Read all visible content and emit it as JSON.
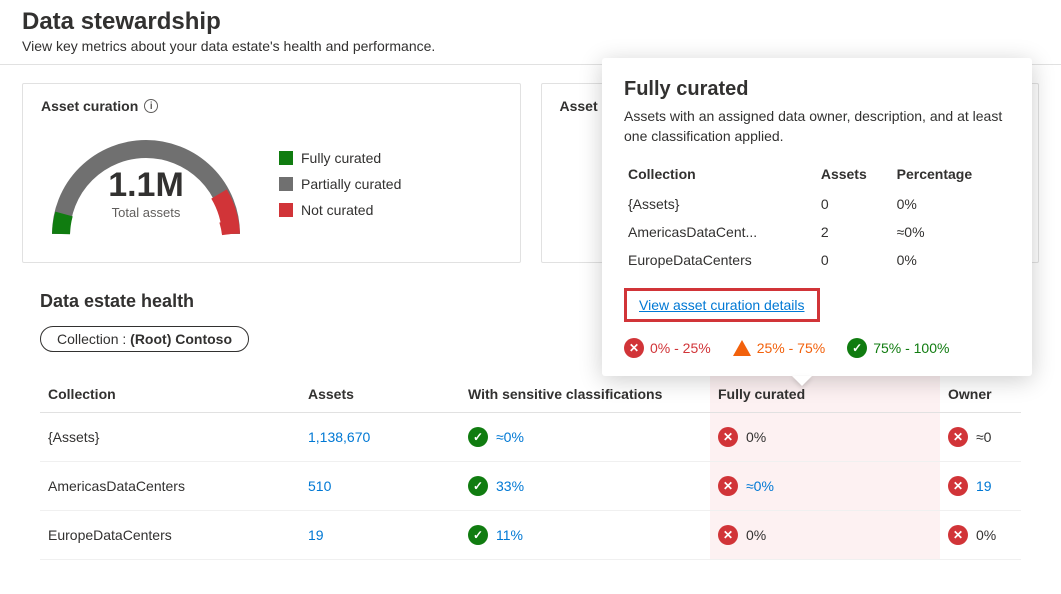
{
  "page": {
    "title": "Data stewardship",
    "subtitle": "View key metrics about your data estate's health and performance."
  },
  "cards": {
    "assetCuration": {
      "title": "Asset curation",
      "total_value": "1.1M",
      "total_label": "Total assets",
      "legend": {
        "fully": "Fully curated",
        "partially": "Partially curated",
        "not": "Not curated"
      }
    },
    "second": {
      "title": "Asset c"
    }
  },
  "popover": {
    "title": "Fully curated",
    "desc": "Assets with an assigned data owner, description, and at least one classification applied.",
    "headers": {
      "collection": "Collection",
      "assets": "Assets",
      "percentage": "Percentage"
    },
    "rows": [
      {
        "collection": "{Assets}",
        "assets": "0",
        "percentage": "0%"
      },
      {
        "collection": "AmericasDataCent...",
        "assets": "2",
        "percentage": "≈0%"
      },
      {
        "collection": "EuropeDataCenters",
        "assets": "0",
        "percentage": "0%"
      }
    ],
    "detail_link": "View asset curation details",
    "ranges": {
      "low": "0% - 25%",
      "mid": "25% - 75%",
      "high": "75% - 100%"
    }
  },
  "health": {
    "section_title": "Data estate health",
    "filter_prefix": "Collection : ",
    "filter_value": "(Root) Contoso",
    "headers": {
      "collection": "Collection",
      "assets": "Assets",
      "sensitive": "With sensitive classifications",
      "fully": "Fully curated",
      "owner": "Owner"
    },
    "rows": [
      {
        "collection": "{Assets}",
        "assets": "1,138,670",
        "sensitive": "≈0%",
        "fully": "0%",
        "owner": "≈0"
      },
      {
        "collection": "AmericasDataCenters",
        "assets": "510",
        "sensitive": "33%",
        "fully": "≈0%",
        "owner": "19"
      },
      {
        "collection": "EuropeDataCenters",
        "assets": "19",
        "sensitive": "11%",
        "fully": "0%",
        "owner": "0%"
      }
    ]
  },
  "chart_data": {
    "type": "pie",
    "title": "Asset curation",
    "total_label": "Total assets",
    "total_value": "1.1M",
    "series": [
      {
        "name": "Fully curated",
        "color": "#107c10",
        "percent": 2
      },
      {
        "name": "Partially curated",
        "color": "#707070",
        "percent": 92
      },
      {
        "name": "Not curated",
        "color": "#d13438",
        "percent": 6
      }
    ],
    "note": "semi-donut gauge; percentages estimated from arc lengths"
  }
}
